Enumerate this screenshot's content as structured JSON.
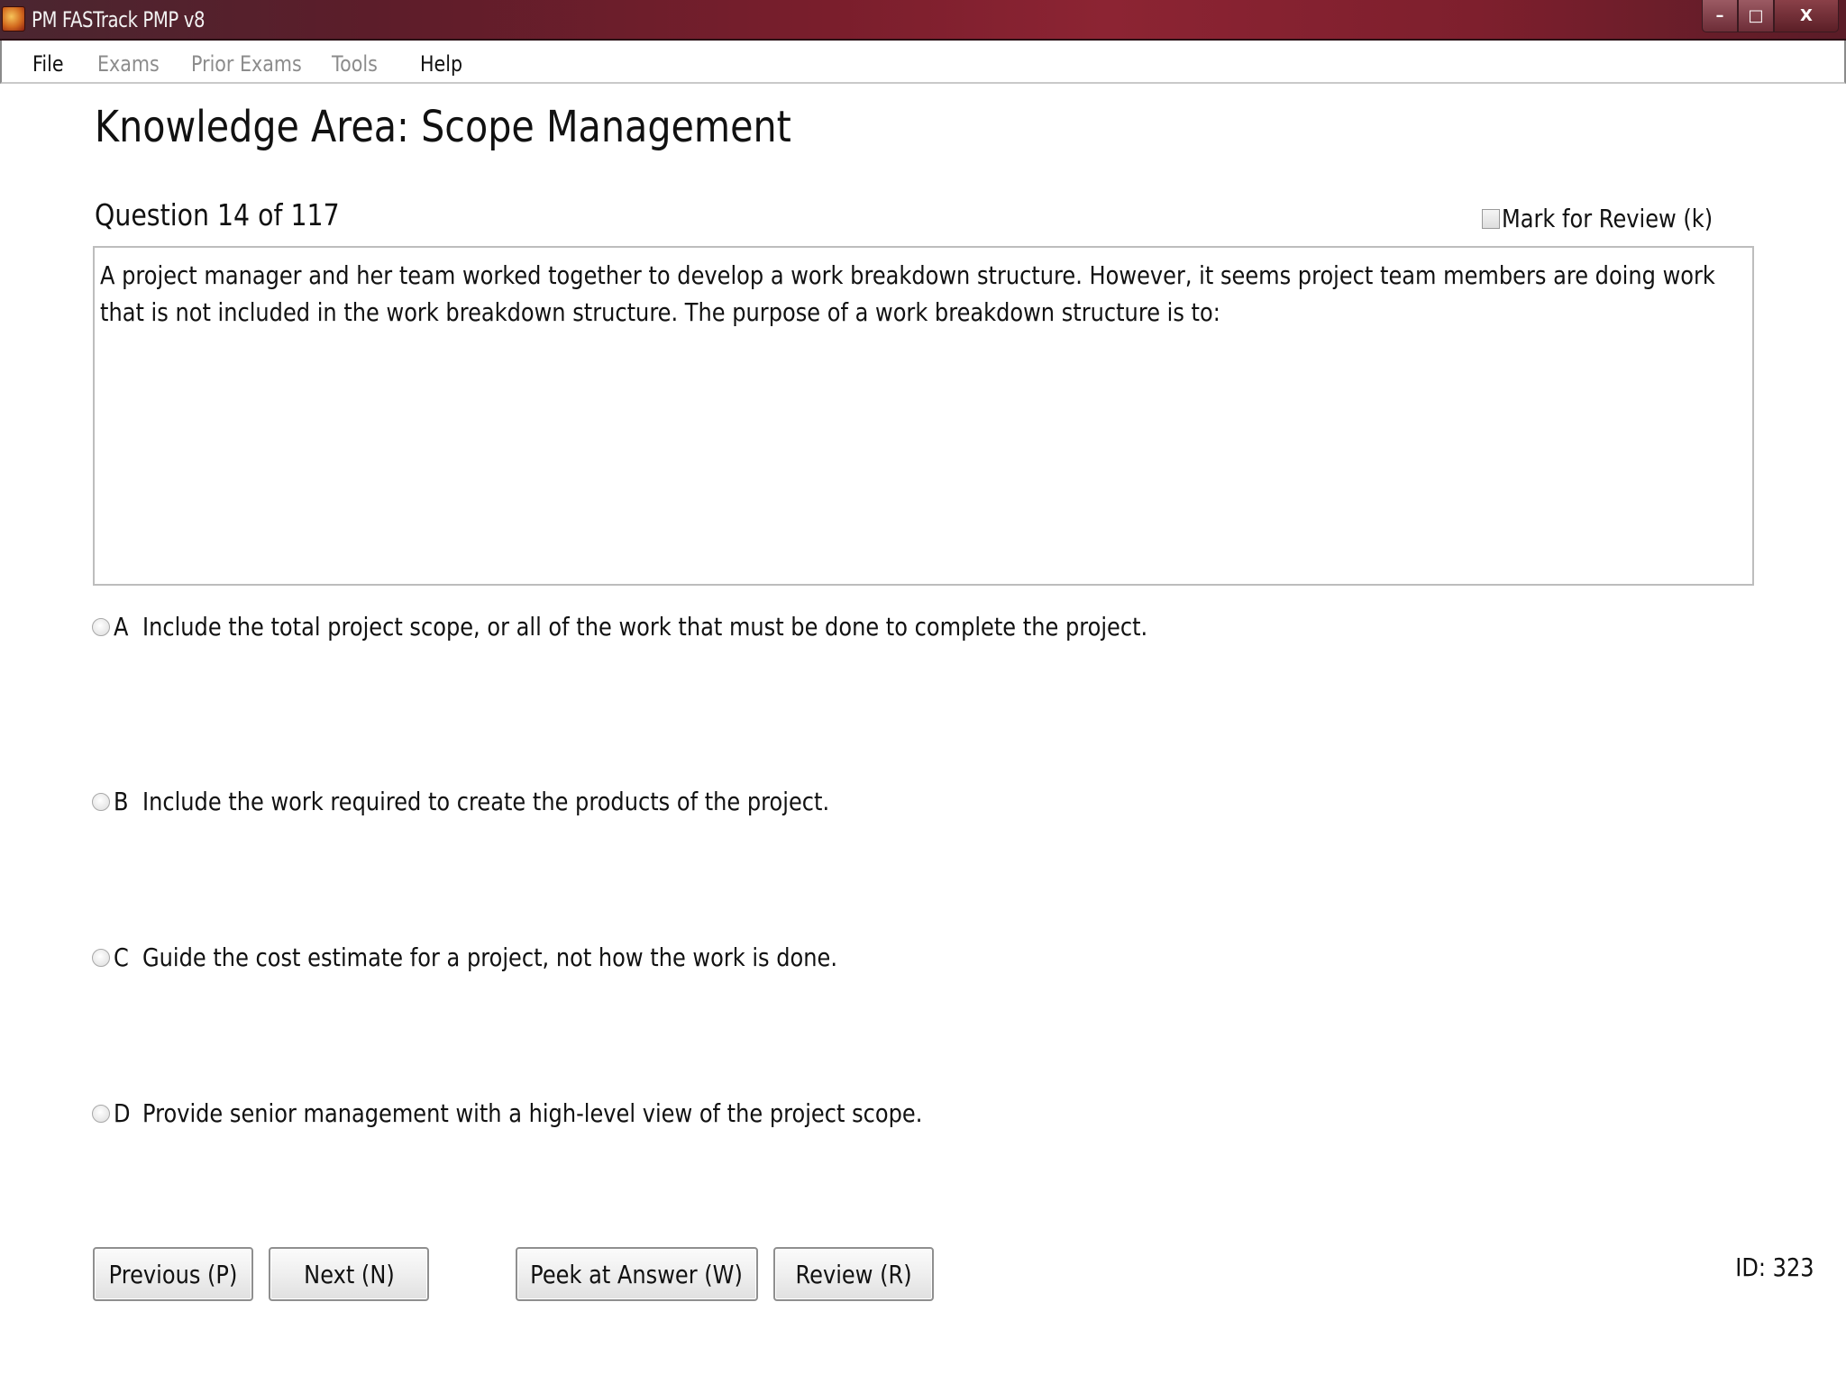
{
  "window": {
    "title": "PM FASTrack PMP v8",
    "controls": {
      "minimize": "–",
      "maximize": "□",
      "close": "X"
    }
  },
  "menu": {
    "items": [
      {
        "label": "File",
        "enabled": true
      },
      {
        "label": "Exams",
        "enabled": false
      },
      {
        "label": "Prior Exams",
        "enabled": false
      },
      {
        "label": "Tools",
        "enabled": false
      },
      {
        "label": "Help",
        "enabled": true
      }
    ]
  },
  "exam": {
    "knowledge_area_title": "Knowledge Area: Scope Management",
    "question_counter": "Question 14 of 117",
    "mark_for_review_label": "Mark for Review (k)",
    "mark_for_review_checked": false,
    "question_text": "A project manager and her team worked together to develop a work breakdown structure. However, it seems project team members are doing work that is not included in the work breakdown structure. The purpose of a work breakdown structure is to:",
    "options": [
      {
        "letter": "A",
        "text": "Include the total project scope, or all of the work that must be done to complete the project.",
        "selected": false
      },
      {
        "letter": "B",
        "text": "Include the work required to create the products of the project.",
        "selected": false
      },
      {
        "letter": "C",
        "text": "Guide the cost estimate for a project, not how the work is done.",
        "selected": false
      },
      {
        "letter": "D",
        "text": "Provide senior management with a high-level view of the project scope.",
        "selected": false
      }
    ],
    "question_id": "ID: 323"
  },
  "buttons": {
    "previous": "Previous (P)",
    "next": "Next (N)",
    "peek": "Peek at Answer (W)",
    "review": "Review (R)"
  },
  "colors": {
    "titlebar": "#7a1e2c",
    "menu_disabled": "#8c8c8c",
    "border": "#bdbdbd"
  }
}
